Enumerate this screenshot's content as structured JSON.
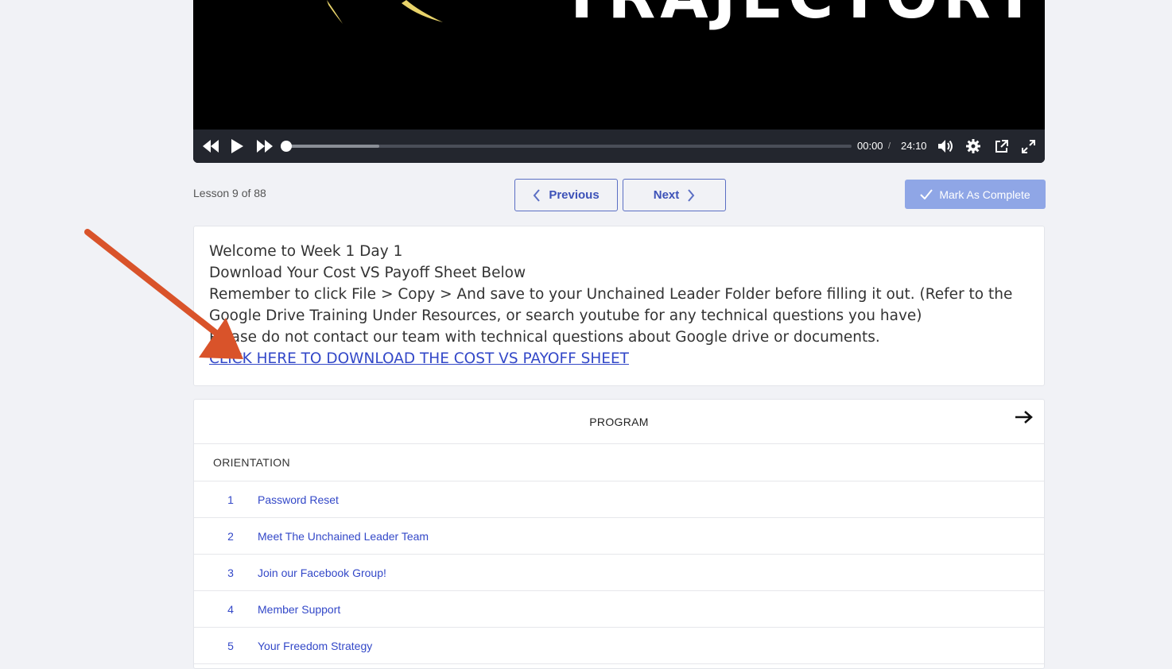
{
  "video": {
    "title_overlay": "TRAJECTORY",
    "current_time": "00:00",
    "time_separator": "/",
    "duration": "24:10",
    "progress_fraction": 0.0,
    "buffered_fraction": 0.165,
    "colors": {
      "bar": "#23262e",
      "accent": "#e8d36a"
    }
  },
  "lesson": {
    "count_label": "Lesson 9 of 88",
    "previous_label": "Previous",
    "next_label": "Next",
    "complete_label": "Mark As Complete"
  },
  "content": {
    "lines": [
      "Welcome to Week 1 Day 1",
      "Download Your Cost VS Payoff Sheet Below",
      "Remember to click File > Copy > And save to your Unchained Leader Folder before filling it out. (Refer to the Google Drive Training Under Resources, or search youtube for any technical questions you have)",
      "Please do not contact our team with technical questions about Google drive or documents."
    ],
    "link_text": "CLICK HERE TO DOWNLOAD THE COST VS PAYOFF SHEET"
  },
  "program": {
    "header": "PROGRAM",
    "section": "ORIENTATION",
    "items": [
      {
        "num": "1",
        "title": "Password Reset"
      },
      {
        "num": "2",
        "title": "Meet The Unchained Leader Team"
      },
      {
        "num": "3",
        "title": "Join our Facebook Group!"
      },
      {
        "num": "4",
        "title": "Member Support"
      },
      {
        "num": "5",
        "title": "Your Freedom Strategy"
      }
    ]
  },
  "annotation": {
    "color": "#d9532a"
  }
}
